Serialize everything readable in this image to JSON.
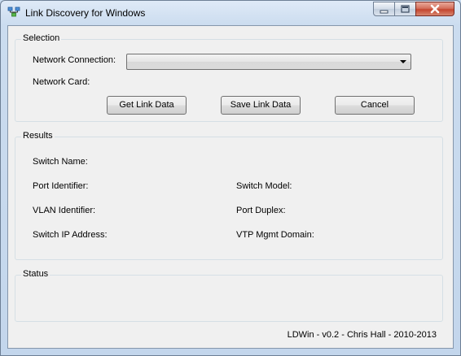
{
  "window": {
    "title": "Link Discovery for Windows"
  },
  "selection": {
    "group_label": "Selection",
    "network_connection_label": "Network Connection:",
    "network_connection_value": "",
    "network_card_label": "Network Card:",
    "buttons": {
      "get_link_data": "Get Link Data",
      "save_link_data": "Save Link Data",
      "cancel": "Cancel"
    }
  },
  "results": {
    "group_label": "Results",
    "switch_name_label": "Switch Name:",
    "port_identifier_label": "Port Identifier:",
    "switch_model_label": "Switch Model:",
    "vlan_identifier_label": "VLAN Identifier:",
    "port_duplex_label": "Port Duplex:",
    "switch_ip_label": "Switch IP Address:",
    "vtp_domain_label": "VTP Mgmt Domain:"
  },
  "status": {
    "group_label": "Status"
  },
  "footer": {
    "credit": "LDWin - v0.2 - Chris Hall - 2010-2013"
  },
  "icons": {
    "app": "network-icon",
    "minimize": "minimize-icon",
    "maximize": "maximize-icon",
    "close": "close-icon",
    "dropdown": "chevron-down-icon"
  },
  "colors": {
    "frame": "#c9dbef",
    "client": "#f0f0f0",
    "close_button": "#c4452f"
  }
}
